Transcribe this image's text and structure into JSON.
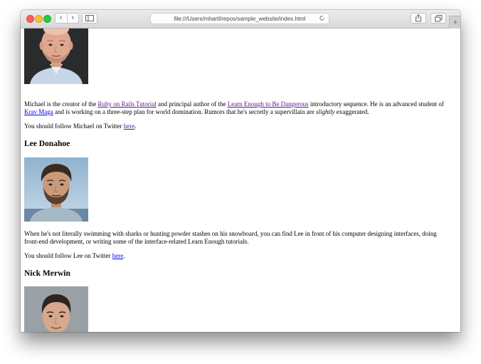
{
  "browser": {
    "url": "file:///Users/mhartl/repos/sample_website/index.html",
    "back_label": "‹",
    "forward_label": "›",
    "new_tab_label": "+"
  },
  "michael": {
    "bio": {
      "t1": "Michael is the creator of the ",
      "link1": "Ruby on Rails Tutorial",
      "t2": " and principal author of the ",
      "link2": "Learn Enough to Be Dangerous",
      "t3": " introductory sequence. He is an advanced student of ",
      "link3": "Krav Maga",
      "t4": " and is working on a three-step plan for world domination. Rumors that he's secretly a supervillain are ",
      "em": "slightly",
      "t5": " exaggerated."
    },
    "follow": {
      "text": "You should follow Michael on Twitter ",
      "link": "here",
      "end": "."
    }
  },
  "lee": {
    "name": "Lee Donahoe",
    "bio": "When he's not literally swimming with sharks or hunting powder stashes on his snowboard, you can find Lee in front of his computer designing interfaces, doing front-end development, or writing some of the interface-related Learn Enough tutorials.",
    "follow": {
      "text": "You should follow Lee on Twitter ",
      "link": "here",
      "end": "."
    }
  },
  "nick": {
    "name": "Nick Merwin"
  },
  "colors": {
    "link_visited": "#551a8b",
    "link_unvisited": "#0000ee",
    "traffic_red": "#fc5f57",
    "traffic_yellow": "#fdbc2e",
    "traffic_green": "#29c840"
  }
}
